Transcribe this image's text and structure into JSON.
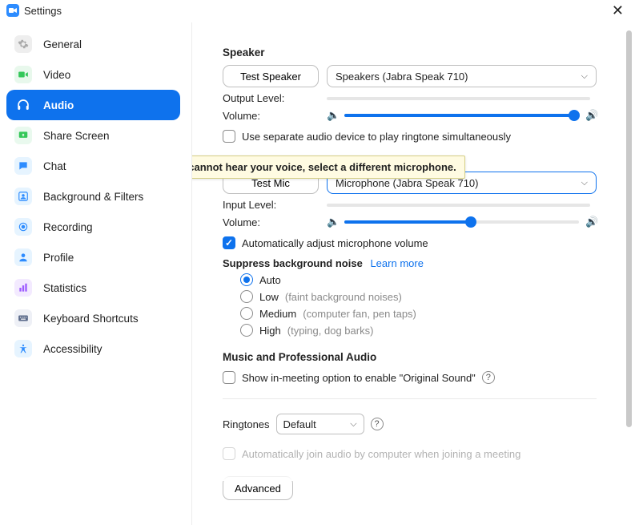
{
  "window": {
    "title": "Settings"
  },
  "sidebar": {
    "items": [
      {
        "label": "General"
      },
      {
        "label": "Video"
      },
      {
        "label": "Audio"
      },
      {
        "label": "Share Screen"
      },
      {
        "label": "Chat"
      },
      {
        "label": "Background & Filters"
      },
      {
        "label": "Recording"
      },
      {
        "label": "Profile"
      },
      {
        "label": "Statistics"
      },
      {
        "label": "Keyboard Shortcuts"
      },
      {
        "label": "Accessibility"
      }
    ]
  },
  "tooltip": "If you cannot hear your voice, select a different microphone.",
  "speaker": {
    "heading": "Speaker",
    "test_btn": "Test Speaker",
    "device": "Speakers (Jabra Speak 710)",
    "output_level_label": "Output Level:",
    "volume_label": "Volume:",
    "separate_device": "Use separate audio device to play ringtone simultaneously"
  },
  "mic": {
    "test_btn": "Test Mic",
    "device": "Microphone (Jabra Speak 710)",
    "input_level_label": "Input Level:",
    "volume_label": "Volume:",
    "auto_adjust": "Automatically adjust microphone volume"
  },
  "suppress": {
    "heading": "Suppress background noise",
    "learn_more": "Learn more",
    "auto": "Auto",
    "low": "Low",
    "low_hint": "(faint background noises)",
    "medium": "Medium",
    "medium_hint": "(computer fan, pen taps)",
    "high": "High",
    "high_hint": "(typing, dog barks)"
  },
  "music": {
    "heading": "Music and Professional Audio",
    "original_sound": "Show in-meeting option to enable \"Original Sound\""
  },
  "ringtones": {
    "label": "Ringtones",
    "value": "Default"
  },
  "auto_join": "Automatically join audio by computer when joining a meeting",
  "advanced_btn": "Advanced"
}
